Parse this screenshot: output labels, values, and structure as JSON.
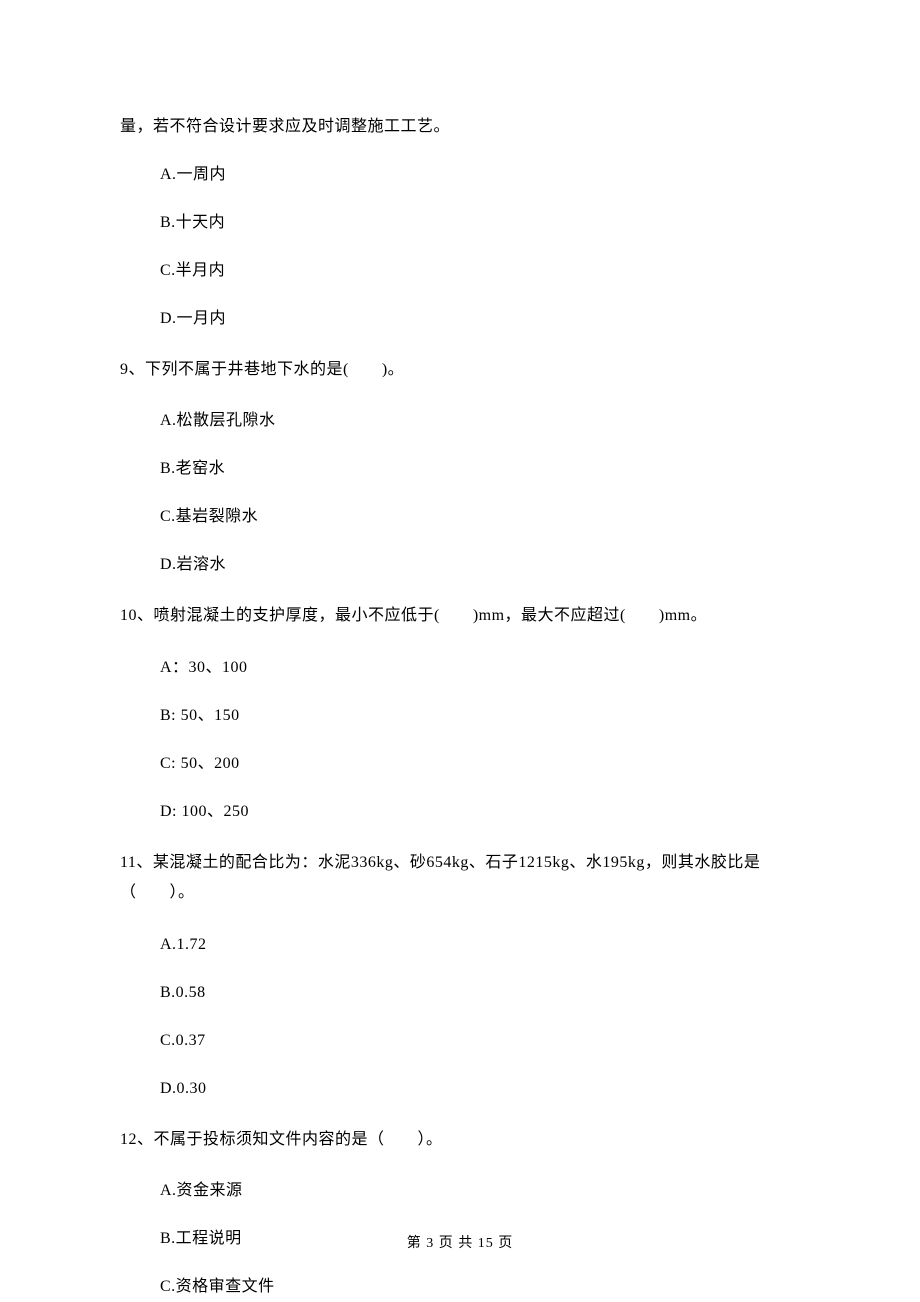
{
  "continuation_line": "量，若不符合设计要求应及时调整施工工艺。",
  "q8_options": {
    "a": "A.一周内",
    "b": "B.十天内",
    "c": "C.半月内",
    "d": "D.一月内"
  },
  "q9": {
    "stem": "9、下列不属于井巷地下水的是(　　)。",
    "a": "A.松散层孔隙水",
    "b": "B.老窑水",
    "c": "C.基岩裂隙水",
    "d": "D.岩溶水"
  },
  "q10": {
    "stem": "10、喷射混凝土的支护厚度，最小不应低于(　　)mm，最大不应超过(　　)mm。",
    "a": "A：30、100",
    "b": "B: 50、150",
    "c": "C: 50、200",
    "d": "D: 100、250"
  },
  "q11": {
    "stem": "11、某混凝土的配合比为：水泥336kg、砂654kg、石子1215kg、水195kg，则其水胶比是（　　）。",
    "a": "A.1.72",
    "b": "B.0.58",
    "c": "C.0.37",
    "d": "D.0.30"
  },
  "q12": {
    "stem": "12、不属于投标须知文件内容的是（　　）。",
    "a": "A.资金来源",
    "b": "B.工程说明",
    "c": "C.资格审查文件"
  },
  "footer": "第 3 页 共 15 页"
}
